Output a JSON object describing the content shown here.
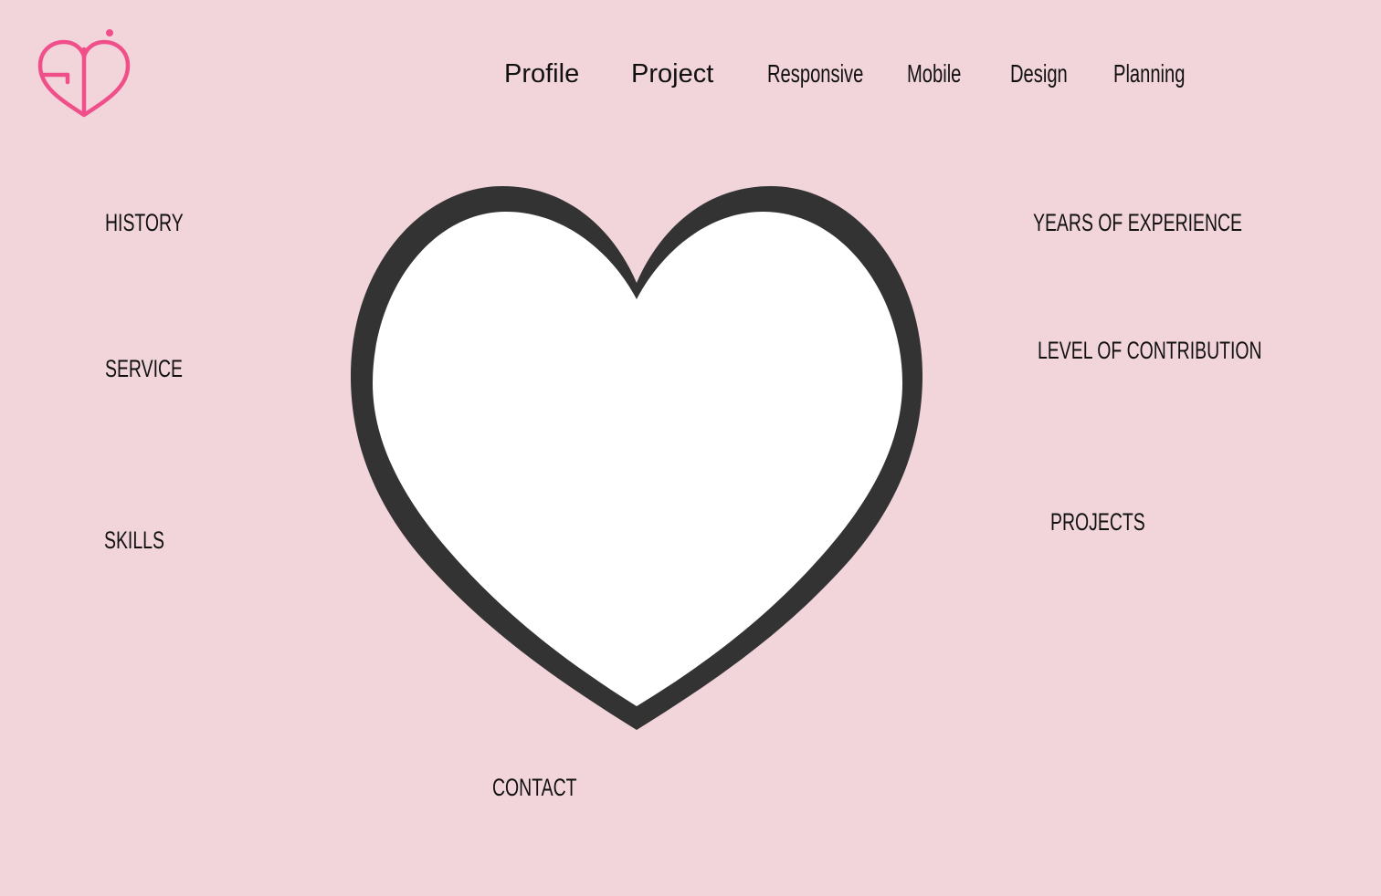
{
  "brand": {
    "logo_icon": "heart-logo-icon",
    "accent_color": "#f0508a"
  },
  "nav": {
    "profile": "Profile",
    "project": "Project",
    "responsive": "Responsive",
    "mobile": "Mobile",
    "design": "Design",
    "planning": "Planning"
  },
  "sections": {
    "history": "HISTORY",
    "service": "SERVICE",
    "skills": "SKILLS",
    "years_of_experience": "YEARS OF EXPERIENCE",
    "level_of_contribution": "LEVEL OF CONTRIBUTION",
    "projects": "PROJECTS",
    "contact": "CONTACT"
  },
  "colors": {
    "background": "#f2d5db",
    "heart_outline": "#333333",
    "heart_fill": "#ffffff"
  },
  "hero": {
    "icon": "heart-icon"
  }
}
